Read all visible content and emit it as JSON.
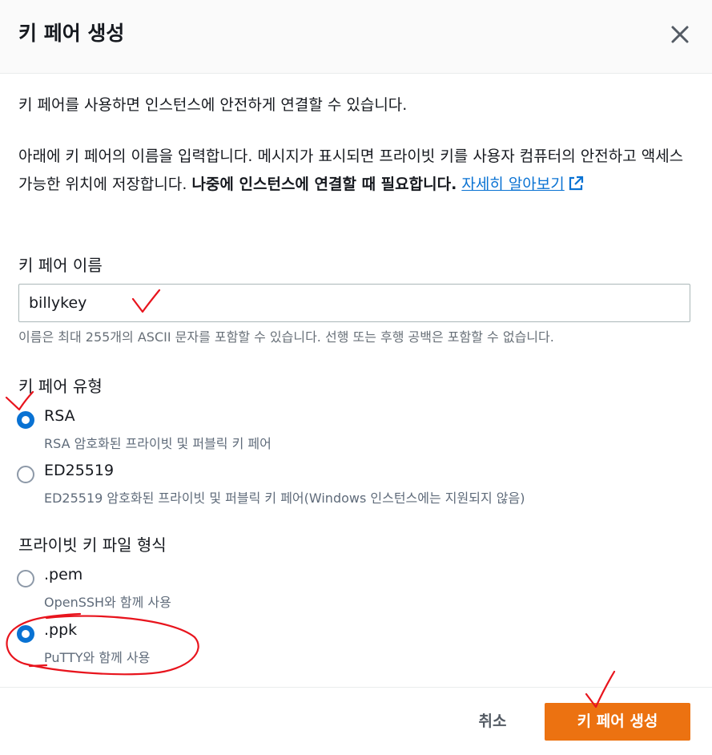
{
  "dialog": {
    "title": "키 페어 생성",
    "intro": "키 페어를 사용하면 인스턴스에 안전하게 연결할 수 있습니다.",
    "desc_text": "아래에 키 페어의 이름을 입력합니다. 메시지가 표시되면 프라이빗 키를 사용자 컴퓨터의 안전하고 액세스 가능한 위치에 저장합니다. ",
    "desc_bold": "나중에 인스턴스에 연결할 때 필요합니다.",
    "learn_more": "자세히 알아보기"
  },
  "name_field": {
    "label": "키 페어 이름",
    "value": "billykey",
    "constraint": "이름은 최대 255개의 ASCII 문자를 포함할 수 있습니다. 선행 또는 후행 공백은 포함할 수 없습니다."
  },
  "key_type": {
    "label": "키 페어 유형",
    "options": [
      {
        "label": "RSA",
        "desc": "RSA 암호화된 프라이빗 및 퍼블릭 키 페어",
        "checked": true
      },
      {
        "label": "ED25519",
        "desc": "ED25519 암호화된 프라이빗 및 퍼블릭 키 페어(Windows 인스턴스에는 지원되지 않음)",
        "checked": false
      }
    ]
  },
  "file_format": {
    "label": "프라이빗 키 파일 형식",
    "options": [
      {
        "label": ".pem",
        "desc": "OpenSSH와 함께 사용",
        "checked": false
      },
      {
        "label": ".ppk",
        "desc": "PuTTY와 함께 사용",
        "checked": true
      }
    ]
  },
  "footer": {
    "cancel": "취소",
    "create": "키 페어 생성"
  },
  "colors": {
    "primary": "#ec7211",
    "link": "#0972d3",
    "annotation": "#e8141d"
  }
}
